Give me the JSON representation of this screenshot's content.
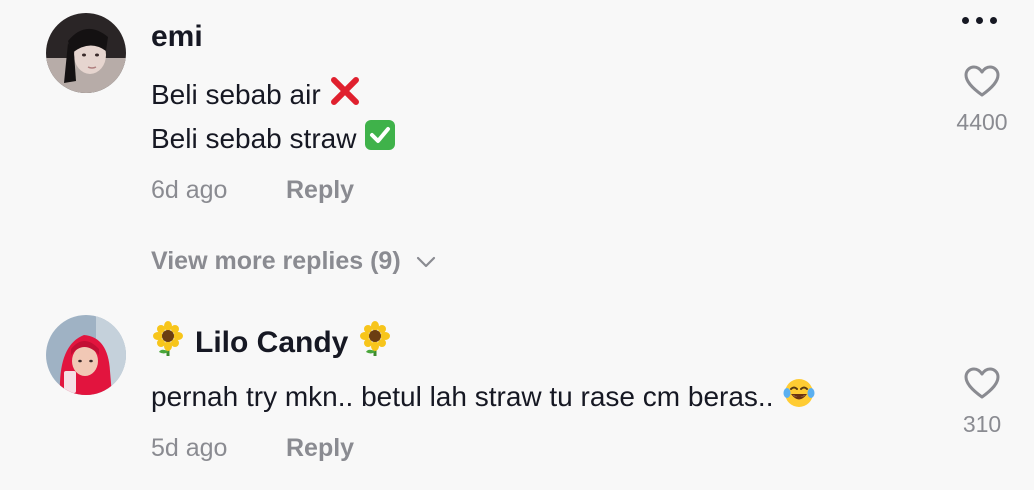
{
  "comments": [
    {
      "username": "emi",
      "lines": [
        "Beli sebab air",
        "Beli sebab straw"
      ],
      "line_icons": [
        "cross-mark-icon",
        "check-mark-icon"
      ],
      "time": "6d ago",
      "reply_label": "Reply",
      "likes": "4400",
      "view_more": "View more replies (9)"
    },
    {
      "username": "Lilo Candy",
      "username_icons": [
        "sunflower-icon",
        "sunflower-icon"
      ],
      "text": "pernah try mkn.. betul lah straw tu rase cm beras..",
      "text_icon": "tears-of-joy-icon",
      "time": "5d ago",
      "reply_label": "Reply",
      "likes": "310"
    }
  ],
  "colors": {
    "background": "#f8f8f8",
    "text_primary": "#161823",
    "text_secondary": "#8a8b91",
    "cross": "#e0202e",
    "check": "#3fb24a"
  }
}
